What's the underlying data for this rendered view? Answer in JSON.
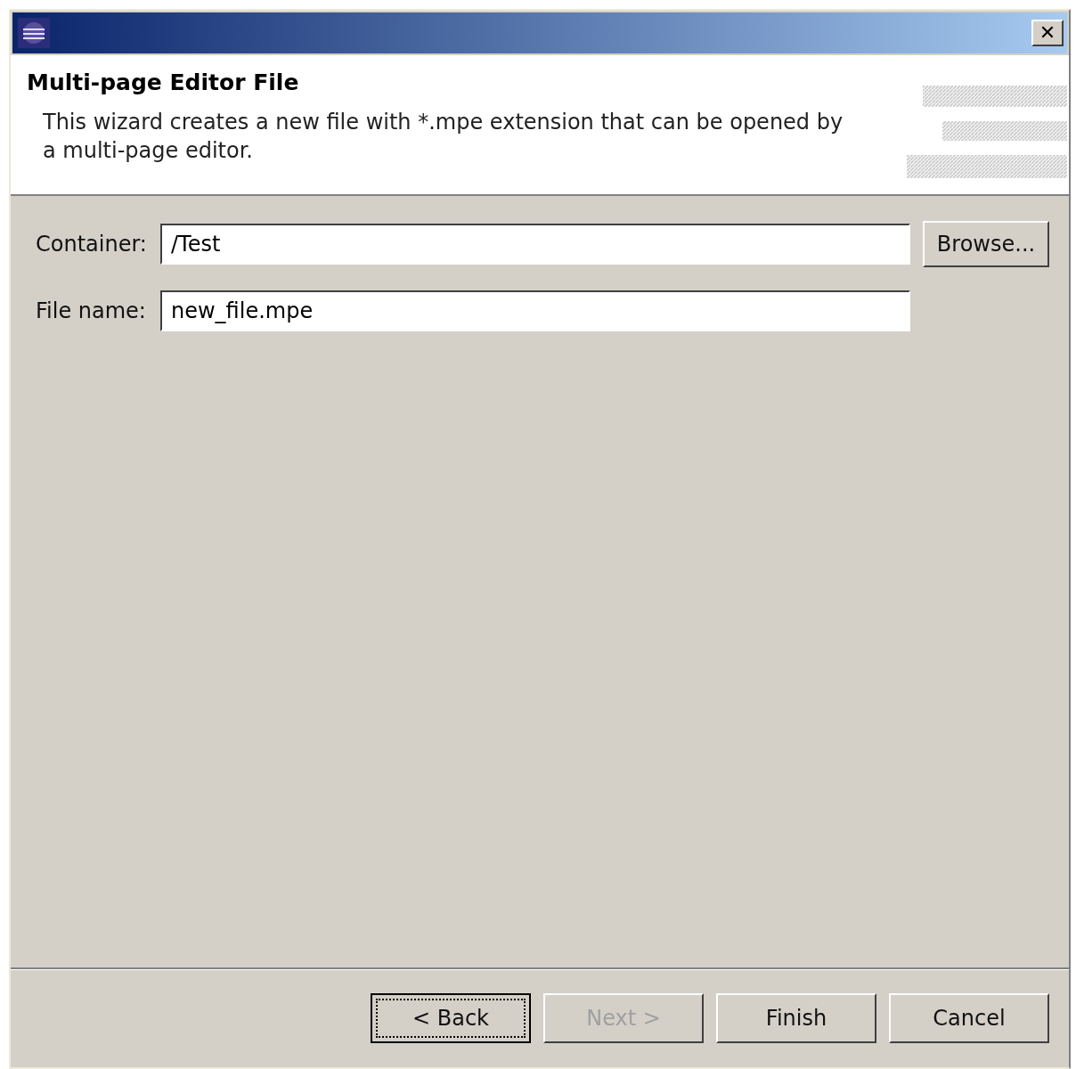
{
  "window": {
    "close_label": "✕"
  },
  "header": {
    "title": "Multi-page Editor File",
    "description": "This wizard creates a new file with *.mpe extension that can be opened by a multi-page editor."
  },
  "fields": [
    {
      "label": "Container:",
      "value": "/Test",
      "button": "Browse..."
    },
    {
      "label": "File name:",
      "value": "new_file.mpe"
    }
  ],
  "buttons": [
    {
      "label": "< Back",
      "focused": true,
      "disabled": false
    },
    {
      "label": "Next >",
      "focused": false,
      "disabled": true
    },
    {
      "label": "Finish",
      "focused": false,
      "disabled": false
    },
    {
      "label": "Cancel",
      "focused": false,
      "disabled": false
    }
  ]
}
